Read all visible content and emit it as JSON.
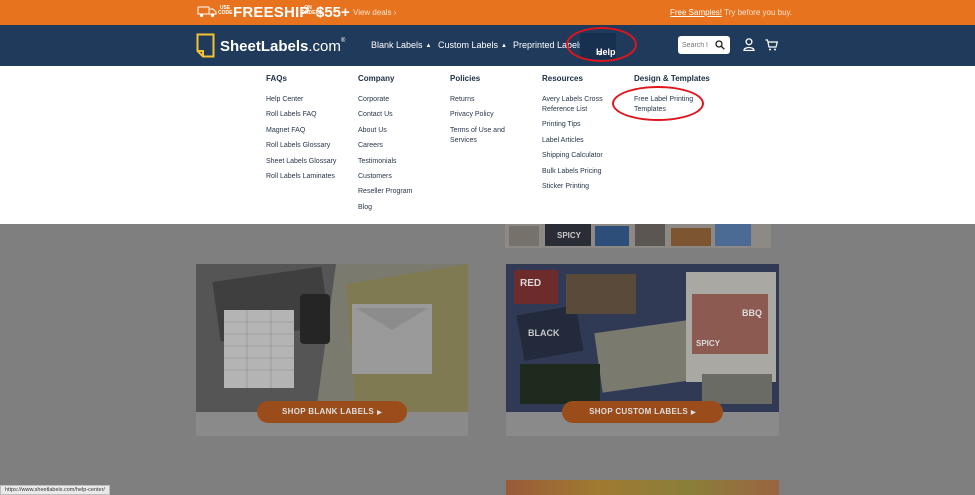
{
  "promo": {
    "use_text": "USE CODE",
    "code": "FREESHIP",
    "on_text": "ON ORDERS",
    "amount": "$55+",
    "view_deals": "View deals ›",
    "free_samples": "Free Samples!",
    "try_before": "Try before you buy."
  },
  "header": {
    "logo_brand": "SheetLabels",
    "logo_domain": ".com",
    "logo_reg": "®",
    "nav": {
      "blank_labels": "Blank Labels",
      "custom_labels": "Custom Labels",
      "preprinted_labels": "Preprinted Labels",
      "help": "Help",
      "caret_up": "▲",
      "caret_down": "⌄"
    },
    "search": {
      "placeholder": "Search l"
    }
  },
  "dropdown": {
    "faqs": {
      "heading": "FAQs",
      "items": [
        "Help Center",
        "Roll Labels FAQ",
        "Magnet FAQ",
        "Roll Labels Glossary",
        "Sheet Labels Glossary",
        "Roll Labels Laminates"
      ]
    },
    "company": {
      "heading": "Company",
      "items": [
        "Corporate",
        "Contact Us",
        "About Us",
        "Careers",
        "Testimonials",
        "Customers",
        "Reseller Program",
        "Blog"
      ]
    },
    "policies": {
      "heading": "Policies",
      "items": [
        "Returns",
        "Privacy Policy",
        "Terms of Use and Services"
      ]
    },
    "resources": {
      "heading": "Resources",
      "items": [
        "Avery Labels Cross Reference List",
        "Printing Tips",
        "Label Articles",
        "Shipping Calculator",
        "Bulk Labels Pricing",
        "Sticker Printing"
      ]
    },
    "design": {
      "heading": "Design & Templates",
      "items": [
        "Free Label Printing Templates"
      ]
    }
  },
  "content": {
    "shop_blank": "SHOP BLANK LABELS",
    "shop_custom": "SHOP CUSTOM LABELS",
    "button_arrow": "▶",
    "sticker_spicy": "SPICY",
    "sticker_bbq": "BBQ",
    "sticker_red": "RED",
    "sticker_black": "BLACK"
  },
  "status_bar": {
    "url": "https://www.sheetlabels.com/help-center/"
  },
  "colors": {
    "promo": "#e8731f",
    "header": "#203a5c",
    "annotation": "#e0151c"
  }
}
